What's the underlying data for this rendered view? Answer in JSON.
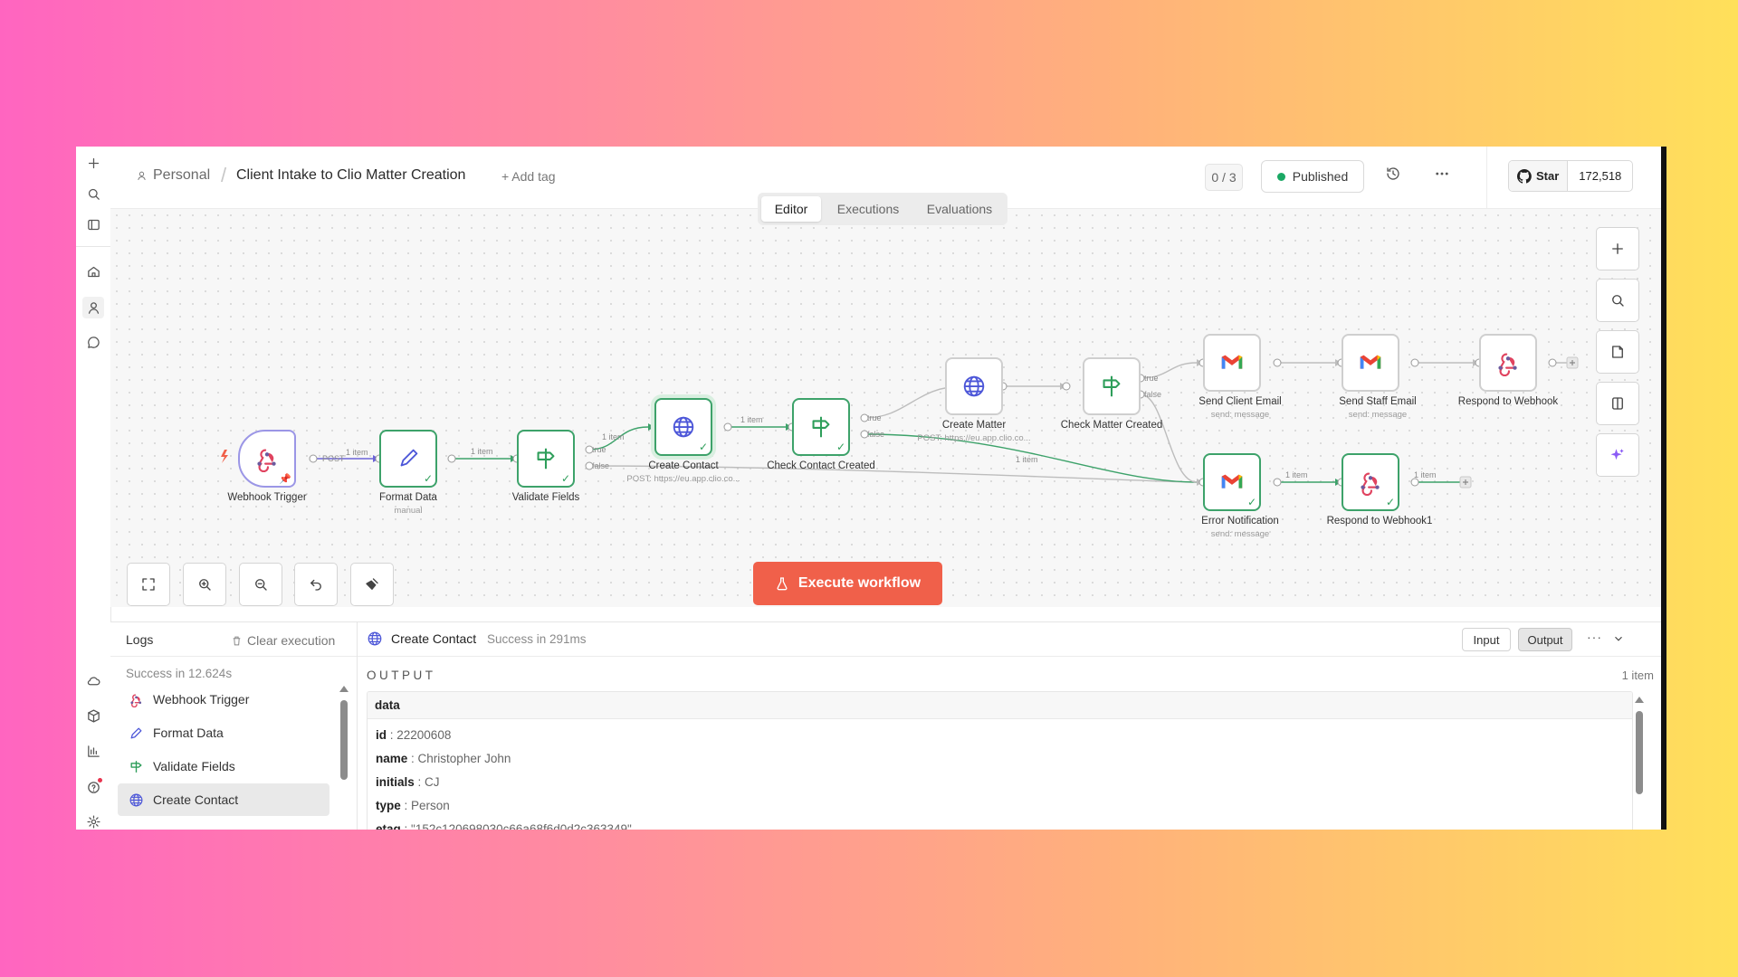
{
  "header": {
    "breadcrumb_owner": "Personal",
    "workflow_title": "Client Intake to Clio Matter Creation",
    "add_tag": "+ Add tag",
    "counter": "0 / 3",
    "status": "Published",
    "github_star": "Star",
    "github_count": "172,518"
  },
  "tabs": [
    {
      "label": "Editor",
      "active": true
    },
    {
      "label": "Executions",
      "active": false
    },
    {
      "label": "Evaluations",
      "active": false
    }
  ],
  "nodes": {
    "webhook_trigger": {
      "label": "Webhook Trigger",
      "sub": ""
    },
    "format_data": {
      "label": "Format Data",
      "sub": "manual"
    },
    "validate_fields": {
      "label": "Validate Fields",
      "sub": ""
    },
    "create_contact": {
      "label": "Create Contact",
      "sub": "POST: https://eu.app.clio.co..."
    },
    "check_contact_created": {
      "label": "Check Contact Created",
      "sub": ""
    },
    "create_matter": {
      "label": "Create Matter",
      "sub": "POST: https://eu.app.clio.co..."
    },
    "check_matter_created": {
      "label": "Check Matter Created",
      "sub": ""
    },
    "send_client_email": {
      "label": "Send Client Email",
      "sub": "send: message"
    },
    "send_staff_email": {
      "label": "Send Staff Email",
      "sub": "send: message"
    },
    "respond_to_webhook": {
      "label": "Respond to Webhook",
      "sub": ""
    },
    "error_notification": {
      "label": "Error Notification",
      "sub": "send: message"
    },
    "respond_to_webhook1": {
      "label": "Respond to Webhook1",
      "sub": ""
    }
  },
  "edge_labels": {
    "post": "POST",
    "one_item": "1 item",
    "true": "true",
    "false": "false"
  },
  "execute_button": "Execute workflow",
  "logs": {
    "title": "Logs",
    "clear": "Clear execution",
    "summary": "Success in 12.624s",
    "items": [
      {
        "label": "Webhook Trigger",
        "icon": "webhook-icon",
        "selected": false
      },
      {
        "label": "Format Data",
        "icon": "pencil-icon",
        "selected": false
      },
      {
        "label": "Validate Fields",
        "icon": "signpost-icon",
        "selected": false
      },
      {
        "label": "Create Contact",
        "icon": "globe-icon",
        "selected": true
      }
    ]
  },
  "output": {
    "node_name": "Create Contact",
    "status": "Success in 291ms",
    "input_btn": "Input",
    "output_btn": "Output",
    "more": "···",
    "section_label": "OUTPUT",
    "item_count": "1 item",
    "data_header": "data",
    "fields": [
      {
        "key": "id",
        "value": "22200608"
      },
      {
        "key": "name",
        "value": "Christopher John"
      },
      {
        "key": "initials",
        "value": "CJ"
      },
      {
        "key": "type",
        "value": "Person"
      },
      {
        "key": "etag",
        "value": "\"152c120698030c66a68f6d0d2c363349\""
      }
    ]
  },
  "colors": {
    "success_green": "#3da26a",
    "execute_button": "#f0604a",
    "published_dot": "#1aa864",
    "trigger_border": "#9b96e6",
    "ai_sparkle": "#8b5cf6"
  }
}
